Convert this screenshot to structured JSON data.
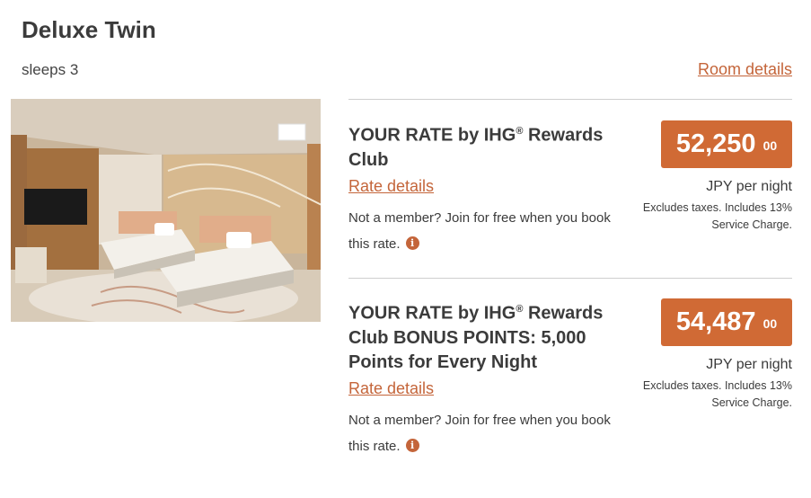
{
  "room": {
    "title": "Deluxe Twin",
    "sleeps": "sleeps 3",
    "details_link": "Room details",
    "photo_icon": "room-photo"
  },
  "rates": [
    {
      "name_prefix": "YOUR RATE by IHG",
      "reg": "®",
      "name_suffix": " Rewards Club",
      "details_link": "Rate details",
      "member_note": "Not a member? Join for free when you book this rate.",
      "info_icon": "i",
      "price": "52,250",
      "cents": "00",
      "per_night": "JPY per night",
      "tax_note": "Excludes taxes. Includes 13% Service Charge."
    },
    {
      "name_prefix": "YOUR RATE by IHG",
      "reg": "®",
      "name_suffix": " Rewards Club BONUS POINTS: 5,000 Points for Every Night",
      "details_link": "Rate details",
      "member_note": "Not a member? Join for free when you book this rate.",
      "info_icon": "i",
      "price": "54,487",
      "cents": "00",
      "per_night": "JPY per night",
      "tax_note": "Excludes taxes. Includes 13% Service Charge."
    }
  ],
  "colors": {
    "accent": "#c4653a",
    "price_bg": "#d06a35",
    "divider": "#cfcfcf"
  }
}
